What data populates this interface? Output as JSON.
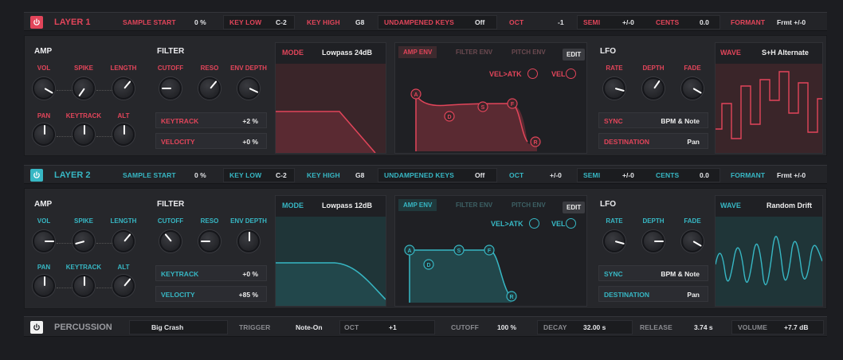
{
  "colors": {
    "red": "#e2455a",
    "teal": "#37b7c4",
    "bg": "#1c1d21"
  },
  "layer1": {
    "title": "LAYER 1",
    "header": {
      "sample_start_label": "SAMPLE START",
      "sample_start": "0 %",
      "key_low_label": "KEY LOW",
      "key_low": "C-2",
      "key_high_label": "KEY HIGH",
      "key_high": "G8",
      "undampened_label": "UNDAMPENED KEYS",
      "undampened": "Off",
      "oct_label": "OCT",
      "oct": "-1",
      "semi_label": "SEMI",
      "semi": "+/-0",
      "cents_label": "CENTS",
      "cents": "0.0",
      "formant_label": "FORMANT",
      "formant": "Frmt +/-0"
    },
    "amp": {
      "title": "AMP",
      "vol": "VOL",
      "spike": "SPIKE",
      "length": "LENGTH",
      "pan": "PAN",
      "keytrack": "KEYTRACK",
      "alt": "ALT"
    },
    "filter": {
      "title": "FILTER",
      "cutoff": "CUTOFF",
      "reso": "RESO",
      "env_depth": "ENV DEPTH",
      "keytrack_label": "KEYTRACK",
      "keytrack": "+2 %",
      "velocity_label": "VELOCITY",
      "velocity": "+0 %"
    },
    "mode": {
      "label": "MODE",
      "value": "Lowpass 24dB"
    },
    "env": {
      "tab_amp": "AMP ENV",
      "tab_filter": "FILTER ENV",
      "tab_pitch": "PITCH ENV",
      "edit": "EDIT",
      "vel_atk": "VEL>ATK",
      "vel": "VEL",
      "a": "A",
      "d": "D",
      "s": "S",
      "f": "F",
      "r": "R"
    },
    "lfo": {
      "title": "LFO",
      "rate": "RATE",
      "depth": "DEPTH",
      "fade": "FADE",
      "sync_label": "SYNC",
      "sync": "BPM & Note",
      "dest_label": "DESTINATION",
      "dest": "Pan"
    },
    "wave": {
      "label": "WAVE",
      "value": "S+H Alternate"
    }
  },
  "layer2": {
    "title": "LAYER 2",
    "header": {
      "sample_start_label": "SAMPLE START",
      "sample_start": "0 %",
      "key_low_label": "KEY LOW",
      "key_low": "C-2",
      "key_high_label": "KEY HIGH",
      "key_high": "G8",
      "undampened_label": "UNDAMPENED KEYS",
      "undampened": "Off",
      "oct_label": "OCT",
      "oct": "+/-0",
      "semi_label": "SEMI",
      "semi": "+/-0",
      "cents_label": "CENTS",
      "cents": "0.0",
      "formant_label": "FORMANT",
      "formant": "Frmt +/-0"
    },
    "amp": {
      "title": "AMP",
      "vol": "VOL",
      "spike": "SPIKE",
      "length": "LENGTH",
      "pan": "PAN",
      "keytrack": "KEYTRACK",
      "alt": "ALT"
    },
    "filter": {
      "title": "FILTER",
      "cutoff": "CUTOFF",
      "reso": "RESO",
      "env_depth": "ENV DEPTH",
      "keytrack_label": "KEYTRACK",
      "keytrack": "+0 %",
      "velocity_label": "VELOCITY",
      "velocity": "+85 %"
    },
    "mode": {
      "label": "MODE",
      "value": "Lowpass 12dB"
    },
    "env": {
      "tab_amp": "AMP ENV",
      "tab_filter": "FILTER ENV",
      "tab_pitch": "PITCH ENV",
      "edit": "EDIT",
      "vel_atk": "VEL>ATK",
      "vel": "VEL",
      "a": "A",
      "d": "D",
      "s": "S",
      "f": "F",
      "r": "R"
    },
    "lfo": {
      "title": "LFO",
      "rate": "RATE",
      "depth": "DEPTH",
      "fade": "FADE",
      "sync_label": "SYNC",
      "sync": "BPM & Note",
      "dest_label": "DESTINATION",
      "dest": "Pan"
    },
    "wave": {
      "label": "WAVE",
      "value": "Random Drift"
    }
  },
  "percussion": {
    "title": "PERCUSSION",
    "sample": "Big Crash",
    "trigger_label": "TRIGGER",
    "trigger": "Note-On",
    "oct_label": "OCT",
    "oct": "+1",
    "cutoff_label": "CUTOFF",
    "cutoff": "100 %",
    "decay_label": "DECAY",
    "decay": "32.00 s",
    "release_label": "RELEASE",
    "release": "3.74 s",
    "volume_label": "VOLUME",
    "volume": "+7.7 dB"
  }
}
